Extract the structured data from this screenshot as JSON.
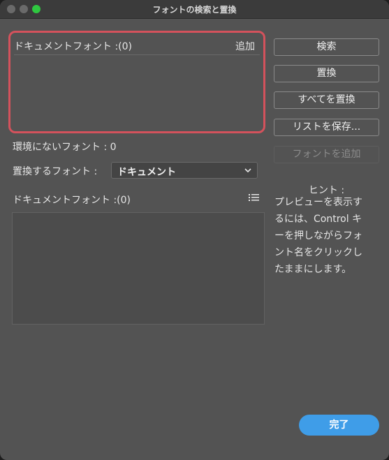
{
  "window": {
    "title": "フォントの検索と置換"
  },
  "document_fonts_panel": {
    "label": "ドキュメントフォント :(0)",
    "add_label": "追加"
  },
  "missing_fonts": {
    "label": "環境にないフォント : 0"
  },
  "replace_with": {
    "label": "置換するフォント :",
    "selected": "ドキュメント"
  },
  "replacement_list": {
    "label": "ドキュメントフォント :(0)"
  },
  "buttons": {
    "search": "検索",
    "replace": "置換",
    "replace_all": "すべてを置換",
    "save_list": "リストを保存...",
    "add_font": "フォントを追加",
    "done": "完了"
  },
  "hint": {
    "title": "ヒント :",
    "body": "プレビューを表示す\nるには、Control キ\nーを押しながらフォ\nント名をクリックし\nたままにします。"
  },
  "colors": {
    "window_bg": "#535353",
    "highlight_border": "#d4525c",
    "primary_button": "#3f9de8",
    "zoom_button": "#2fc840"
  }
}
